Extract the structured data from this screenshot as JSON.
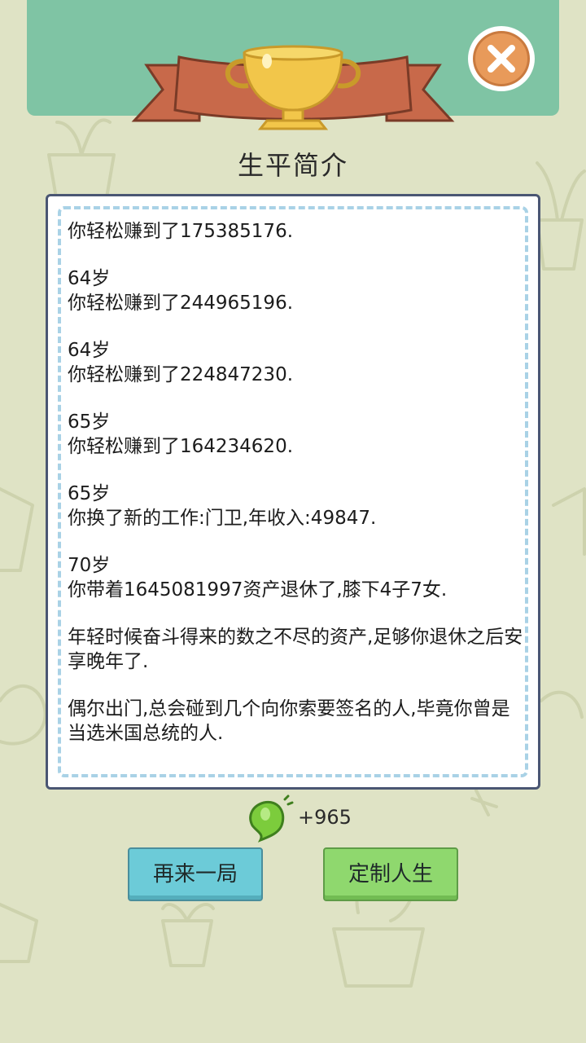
{
  "colors": {
    "background": "#dfe3c5",
    "header": "#7fc4a4",
    "ribbon": "#c8694a",
    "trophy": "#f2c64a",
    "panel_border": "#4a5673",
    "dash": "#a9d2e6",
    "close": "#e89a5a",
    "btn_again": "#6ccbd8",
    "btn_custom": "#8fd86e"
  },
  "icons": {
    "trophy": "trophy-icon",
    "close": "close-icon",
    "reward": "green-seed-icon"
  },
  "title": "生平简介",
  "entries": [
    {
      "age": "",
      "text": "你轻松赚到了175385176."
    },
    {
      "age": "64岁",
      "text": "你轻松赚到了244965196."
    },
    {
      "age": "64岁",
      "text": "你轻松赚到了224847230."
    },
    {
      "age": "65岁",
      "text": "你轻松赚到了164234620."
    },
    {
      "age": "65岁",
      "text": "你换了新的工作:门卫,年收入:49847."
    },
    {
      "age": "70岁",
      "text": "你带着1645081997资产退休了,膝下4子7女."
    },
    {
      "age": "",
      "text": "年轻时候奋斗得来的数之不尽的资产,足够你退休之后安享晚年了."
    },
    {
      "age": "",
      "text": "偶尔出门,总会碰到几个向你索要签名的人,毕竟你曾是当选米国总统的人."
    }
  ],
  "reward": {
    "amount": "+965"
  },
  "buttons": {
    "again": "再来一局",
    "custom": "定制人生"
  }
}
